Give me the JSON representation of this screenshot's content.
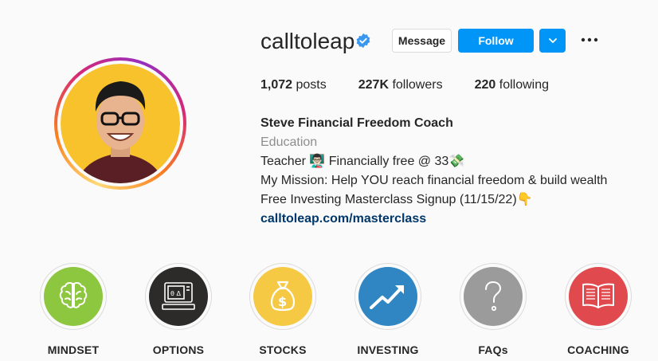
{
  "profile": {
    "username": "calltoleap",
    "message_label": "Message",
    "follow_label": "Follow",
    "stats": {
      "posts_count": "1,072",
      "posts_label": "posts",
      "followers_count": "227K",
      "followers_label": "followers",
      "following_count": "220",
      "following_label": "following"
    },
    "bio": {
      "name": "Steve Financial Freedom Coach",
      "category": "Education",
      "line1": "Teacher 👨🏻‍🏫 Financially free @ 33💸",
      "line2": "My Mission: Help YOU reach financial freedom & build wealth",
      "line3": "Free Investing Masterclass Signup (11/15/22)👇",
      "link": "calltoleap.com/masterclass"
    }
  },
  "highlights": [
    {
      "label": "MINDSET",
      "icon": "brain-icon",
      "color": "#8dc63f"
    },
    {
      "label": "OPTIONS",
      "icon": "computer-icon",
      "color": "#2d2a2a"
    },
    {
      "label": "STOCKS",
      "icon": "money-bag-icon",
      "color": "#f6c945"
    },
    {
      "label": "INVESTING",
      "icon": "trend-up-icon",
      "color": "#2f86c2"
    },
    {
      "label": "FAQs",
      "icon": "question-icon",
      "color": "#9b9b9b"
    },
    {
      "label": "COACHING",
      "icon": "book-icon",
      "color": "#e04a4f"
    }
  ],
  "colors": {
    "follow": "#0095f6",
    "verified": "#3897f0",
    "link": "#00376b"
  }
}
